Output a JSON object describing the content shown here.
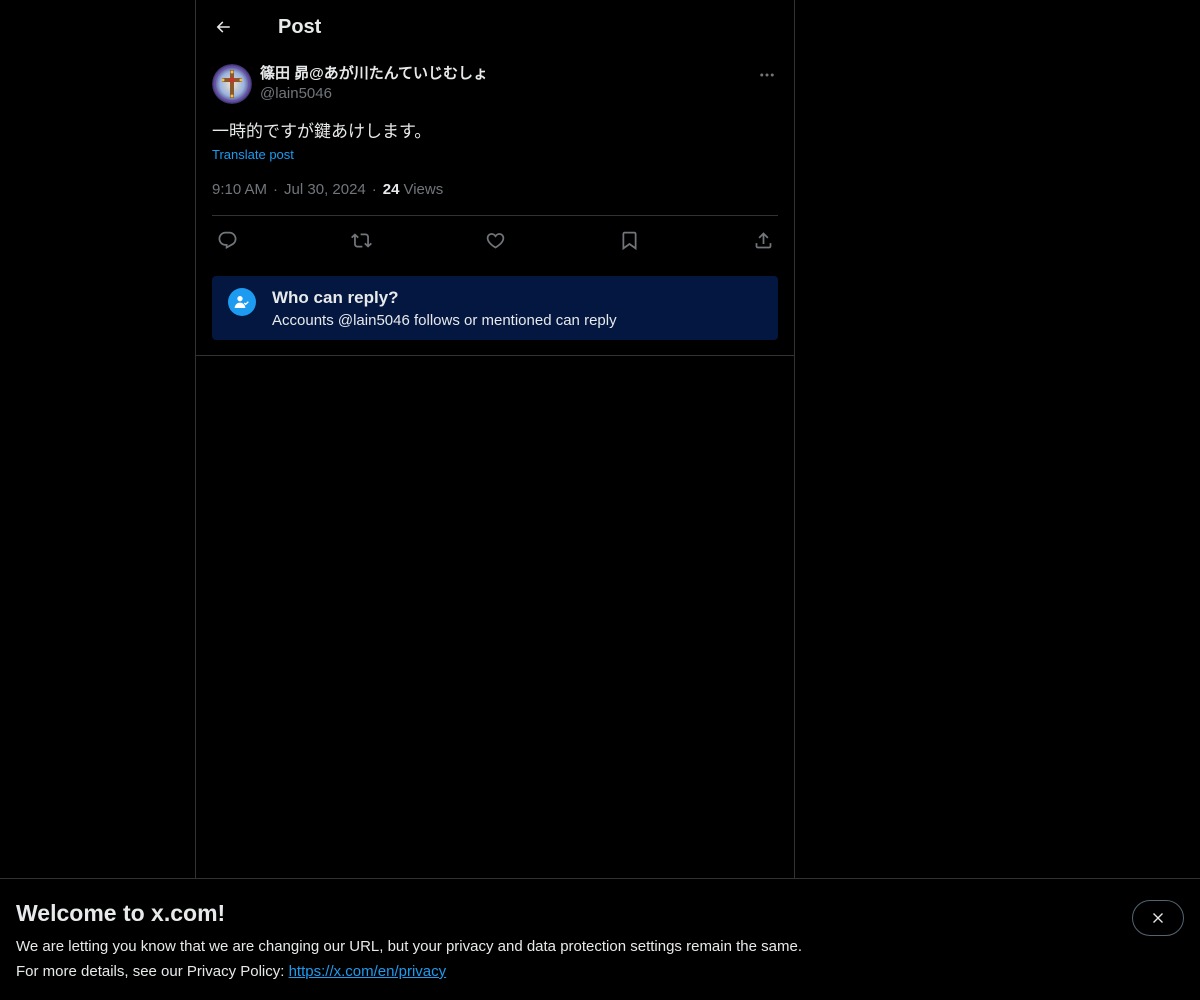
{
  "header": {
    "title": "Post"
  },
  "post": {
    "author": {
      "display_name": "篠田 昴@あが川たんていじむしょ",
      "handle": "@lain5046"
    },
    "text": "一時的ですが鍵あけします。",
    "translate_label": "Translate post",
    "time": "9:10 AM",
    "date": "Jul 30, 2024",
    "views_count": "24",
    "views_label": "Views"
  },
  "reply_restriction": {
    "title": "Who can reply?",
    "subtitle": "Accounts @lain5046 follows or mentioned can reply"
  },
  "banner": {
    "title": "Welcome to x.com!",
    "line1": "We are letting you know that we are changing our URL, but your privacy and data protection settings remain the same.",
    "line2_prefix": "For more details, see our Privacy Policy: ",
    "link_text": "https://x.com/en/privacy"
  },
  "colors": {
    "background": "#000000",
    "accent": "#1d9bf0",
    "muted_text": "#71767b",
    "reply_box_bg": "#031740"
  },
  "icons": {
    "back": "arrow-left-icon",
    "more": "more-horizontal-icon",
    "reply": "reply-icon",
    "repost": "repost-icon",
    "like": "heart-icon",
    "bookmark": "bookmark-icon",
    "share": "share-icon",
    "reply_restriction": "person-check-icon",
    "close": "close-icon"
  }
}
